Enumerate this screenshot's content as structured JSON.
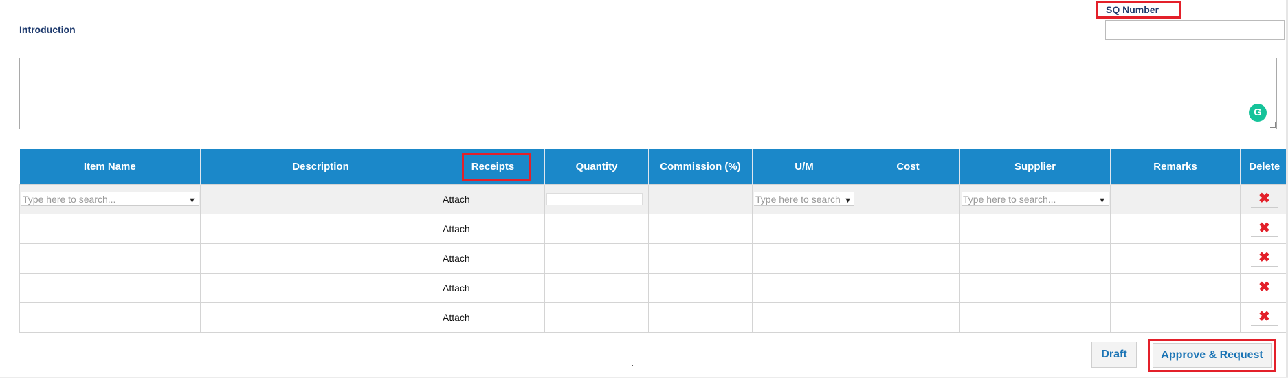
{
  "form": {
    "introduction_label": "Introduction",
    "sq_number_label": "SQ Number",
    "sq_number_value": "",
    "introduction_value": ""
  },
  "table": {
    "headers": [
      "Item Name",
      "Description",
      "Receipts",
      "Quantity",
      "Commission (%)",
      "U/M",
      "Cost",
      "Supplier",
      "Remarks",
      "Delete"
    ],
    "search_placeholder": "Type here to search...",
    "um_placeholder": "Type here to search",
    "rows": [
      {
        "receipts": "Attach"
      },
      {
        "receipts": "Attach"
      },
      {
        "receipts": "Attach"
      },
      {
        "receipts": "Attach"
      },
      {
        "receipts": "Attach"
      }
    ],
    "delete_glyph": "✖"
  },
  "actions": {
    "draft_label": "Draft",
    "approve_label": "Approve & Request"
  },
  "colors": {
    "header_bg": "#1b88c9",
    "highlight": "#e3202a",
    "label_text": "#1f3b6e",
    "button_text": "#1b74b5"
  }
}
